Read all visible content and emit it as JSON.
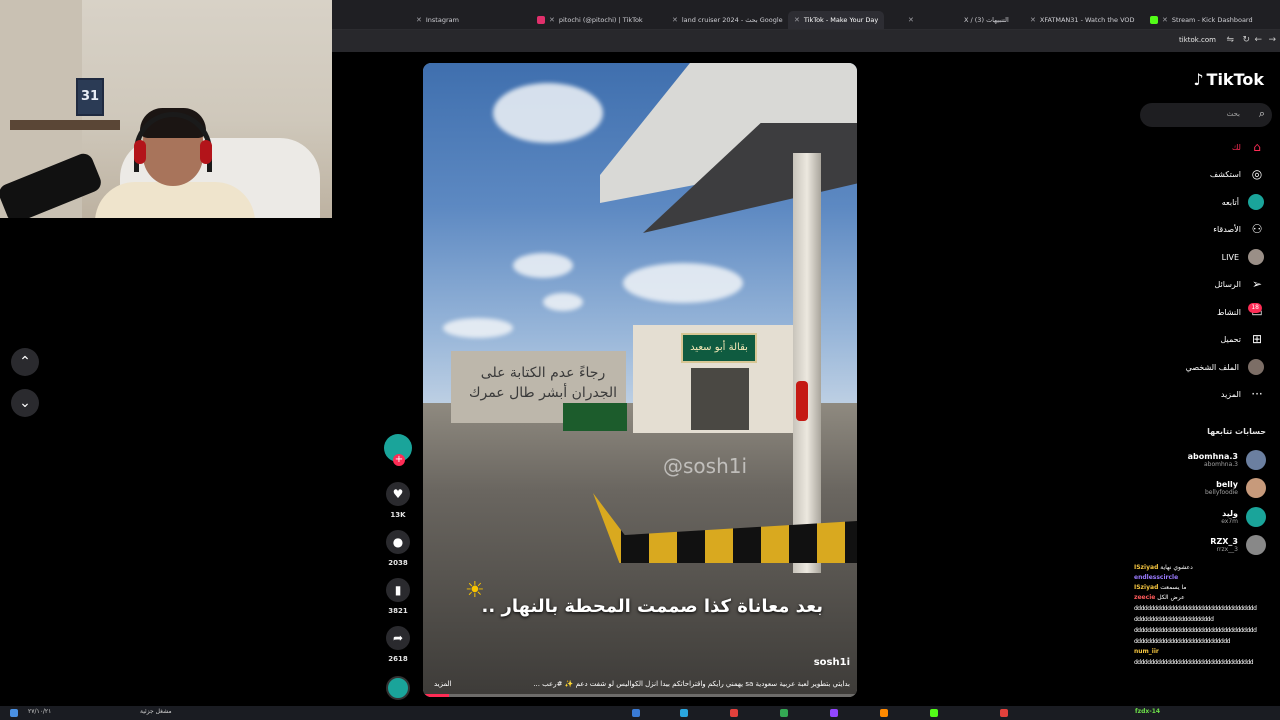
{
  "browser": {
    "tabs": [
      {
        "label": "Instagram",
        "color": "#e1306c"
      },
      {
        "label": "pitochi (@pitochi) | TikTok",
        "color": "#25f4ee"
      },
      {
        "label": "land cruiser 2024 - بحث Google",
        "color": "#4285f4"
      },
      {
        "label": "TikTok - Make Your Day",
        "color": "#ffffff"
      },
      {
        "label": "X / (3) التنبيهات",
        "color": "#ffffff"
      },
      {
        "label": "XFATMAN31 - Watch the VOD",
        "color": "#53fc18"
      },
      {
        "label": "Stream - Kick Dashboard",
        "color": "#53fc18"
      }
    ],
    "url": "tiktok.com"
  },
  "webcam": {
    "poster_number": "31"
  },
  "video": {
    "watermark": "@sosh1i",
    "caption": "بعد معاناة كذا صممت المحطة بالنهار ..",
    "author": "sosh1i",
    "description": "بدايتي بتطوير لعبة عربية سعودية sa يهمني رأيكم واقتراحاتكم بيدا انزل الكواليس لو شفت دعم ✨ #رعب ...",
    "more_label": "المزيد",
    "shop_sign": "بقالة أبو سعيد",
    "wall_text": "رجاءً عدم الكتابة على الجدران أبشر طال عمرك",
    "progress": 0.06
  },
  "actions": {
    "likes": "13K",
    "comments": "2038",
    "saves": "3821",
    "shares": "2618"
  },
  "sidebar": {
    "logo": "TikTok",
    "search_placeholder": "بحث",
    "nav": [
      {
        "label": "لك",
        "icon": "home-icon"
      },
      {
        "label": "استكشف",
        "icon": "compass-icon"
      },
      {
        "label": "أتابعه",
        "icon": "following-avatar"
      },
      {
        "label": "الأصدقاء",
        "icon": "friends-icon"
      },
      {
        "label": "LIVE",
        "icon": "live-avatar"
      },
      {
        "label": "الرسائل",
        "icon": "send-icon"
      },
      {
        "label": "النشاط",
        "icon": "activity-icon"
      },
      {
        "label": "تحميل",
        "icon": "upload-icon"
      },
      {
        "label": "الملف الشخصي",
        "icon": "profile-avatar"
      },
      {
        "label": "المزيد",
        "icon": "more-icon"
      }
    ],
    "activity_badge": "18",
    "following_title": "حسابات تتابعها",
    "following": [
      {
        "name": "abomhna.3",
        "handle": "abomhna.3",
        "color": "#6b7fa0"
      },
      {
        "name": "belly",
        "handle": "bellyfoodie",
        "color": "#c79a7b"
      },
      {
        "name": "وليد",
        "handle": "ex7m",
        "color": "#1aa49a"
      },
      {
        "name": "RZX_3",
        "handle": "rrzx__3",
        "color": "#888888"
      }
    ]
  },
  "chat": {
    "lines": [
      {
        "user": "ISziyad",
        "text": "دعشوي نهاية",
        "color": "#f6c640"
      },
      {
        "user": "endlesscircle",
        "text": "",
        "color": "#9b7bff"
      },
      {
        "user": "ISziyad",
        "text": "ما يسمعت",
        "color": "#f6c640"
      },
      {
        "user": "zeecie",
        "text": "عرض الكل",
        "color": "#ff5a5a"
      }
    ],
    "spam": [
      "ddddddddddddddddddddddddddddddddddddd",
      "dddddddddddddddddddddddd",
      "ddddddddddddddddddddddddddddddddddddd",
      "ddddddddddddddddddddddddddddd",
      "dddddddddddddddddddddddddddddddddddd"
    ],
    "last_user": "num_iir",
    "last_color": "#f6c640"
  },
  "taskbar": {
    "date": "٢٧/١٠/٢١",
    "search": "مشغل جزئية",
    "green_label": "fzdx-14"
  }
}
